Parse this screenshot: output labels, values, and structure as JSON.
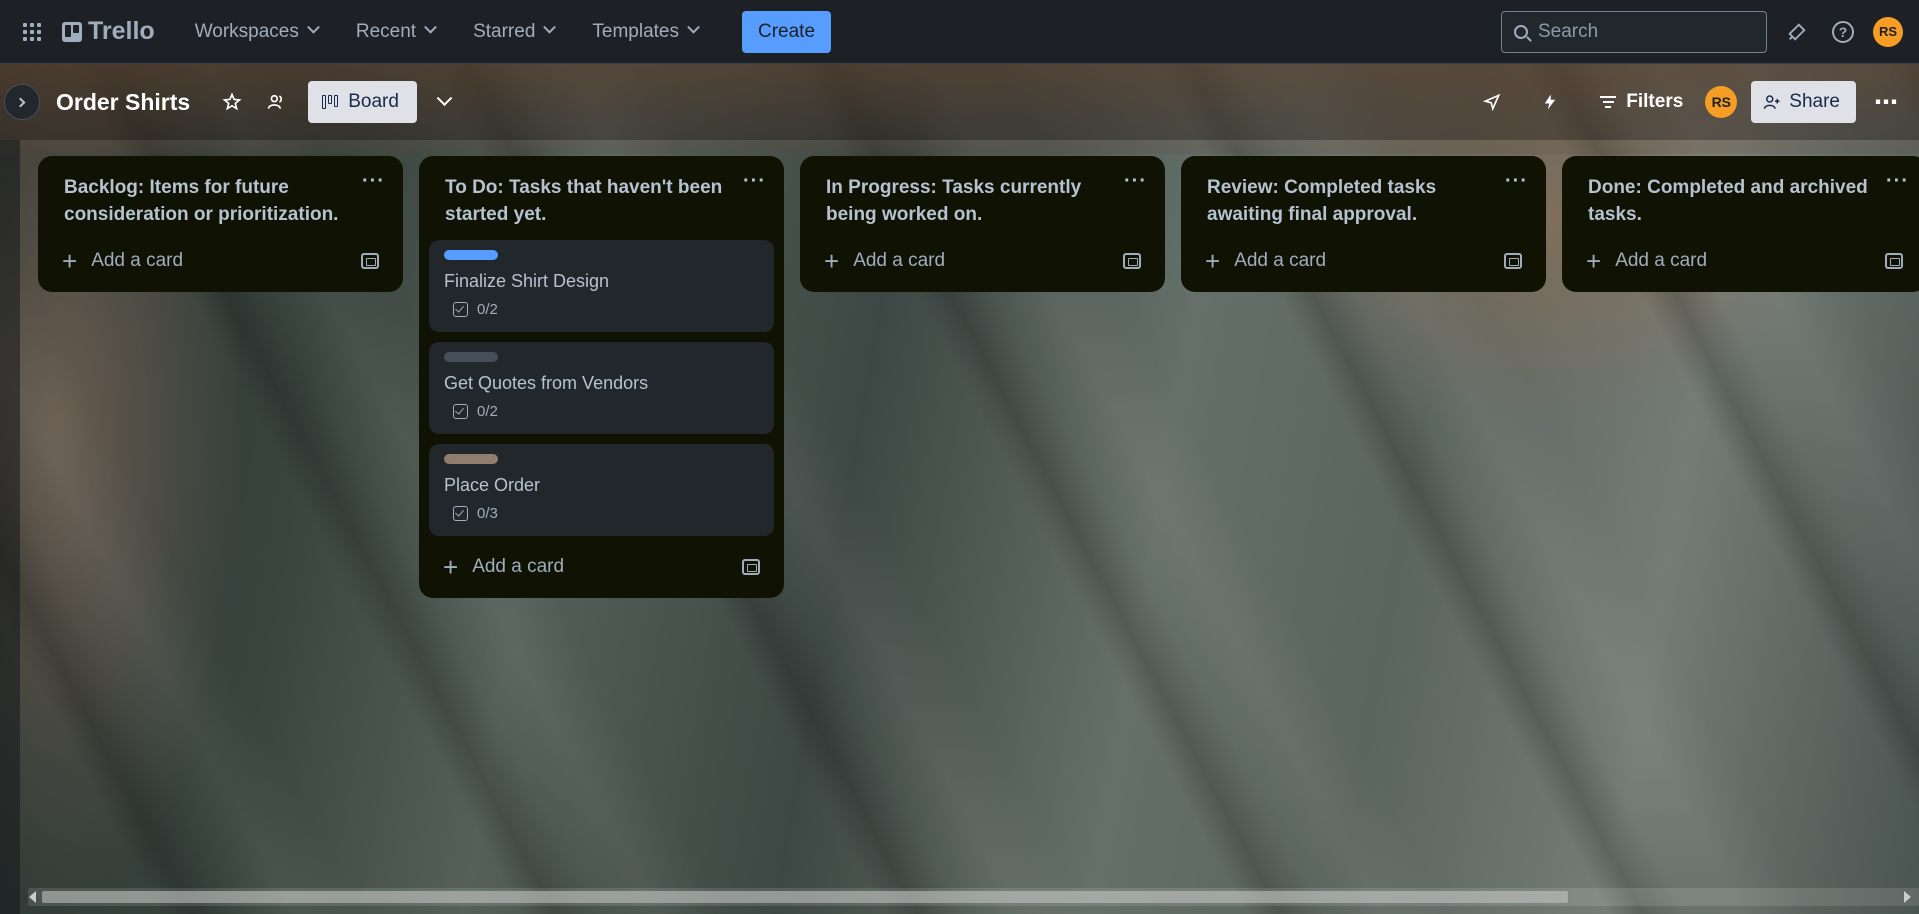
{
  "nav": {
    "logo": "Trello",
    "items": [
      {
        "label": "Workspaces"
      },
      {
        "label": "Recent"
      },
      {
        "label": "Starred"
      },
      {
        "label": "Templates"
      }
    ],
    "create_label": "Create",
    "search_placeholder": "Search",
    "avatar_initials": "RS"
  },
  "board": {
    "title": "Order Shirts",
    "view_label": "Board",
    "filters_label": "Filters",
    "share_label": "Share",
    "member_initials": "RS"
  },
  "lists": [
    {
      "title": "Backlog: Items for future consideration or prioritization.",
      "add_label": "Add a card",
      "cards": []
    },
    {
      "title": "To Do: Tasks that haven't been started yet.",
      "add_label": "Add a card",
      "cards": [
        {
          "title": "Finalize Shirt Design",
          "checklist": "0/2",
          "label_color": "#579dff"
        },
        {
          "title": "Get Quotes from Vendors",
          "checklist": "0/2",
          "label_color": "#454f59"
        },
        {
          "title": "Place Order",
          "checklist": "0/3",
          "label_color": "#8f7e6f"
        }
      ]
    },
    {
      "title": "In Progress: Tasks currently being worked on.",
      "add_label": "Add a card",
      "cards": []
    },
    {
      "title": "Review: Completed tasks awaiting final approval.",
      "add_label": "Add a card",
      "cards": []
    },
    {
      "title": "Done: Completed and archived tasks.",
      "add_label": "Add a card",
      "cards": []
    }
  ],
  "colors": {
    "nav_bg": "#1d2125",
    "list_bg": "#101204",
    "card_bg": "#22272b",
    "create_button": "#579dff",
    "avatar": "#f59d25"
  }
}
